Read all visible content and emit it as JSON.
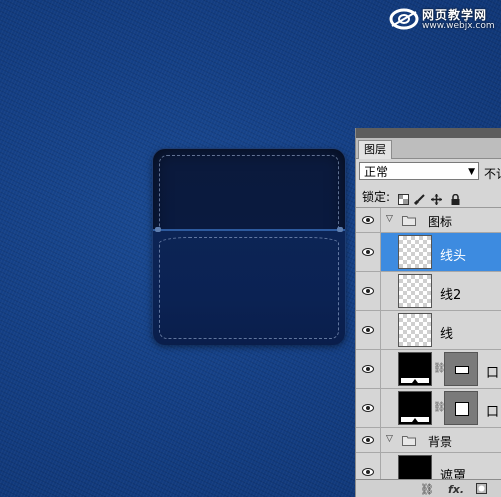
{
  "watermark": {
    "title": "网页教学网",
    "url": "www.webjx.com"
  },
  "layers_panel": {
    "tab": "图层",
    "blend_mode": "正常",
    "opacity_label": "不记",
    "lock_label": "锁定:",
    "lock_icons": [
      "lock-transparent-icon",
      "lock-paint-icon",
      "lock-move-icon",
      "lock-all-icon"
    ],
    "groups": [
      {
        "name": "图标",
        "expanded": true,
        "layers": [
          {
            "name": "线头",
            "selected": true,
            "thumbnail": "transparent"
          },
          {
            "name": "线2",
            "selected": false,
            "thumbnail": "transparent"
          },
          {
            "name": "线",
            "selected": false,
            "thumbnail": "transparent"
          },
          {
            "name": "口",
            "selected": false,
            "thumbnail": "black",
            "has_mask": true
          },
          {
            "name": "口",
            "selected": false,
            "thumbnail": "black",
            "has_mask": true
          }
        ]
      },
      {
        "name": "背景",
        "expanded": true,
        "layers": [
          {
            "name": "遮罩",
            "selected": false,
            "thumbnail": "black"
          }
        ]
      }
    ],
    "bottom_icons": [
      "link-layers-icon",
      "fx-icon",
      "add-mask-icon"
    ],
    "bottom_fx_label": "fx."
  },
  "colors": {
    "selection": "#3d8be0",
    "denim": "#143f85"
  }
}
